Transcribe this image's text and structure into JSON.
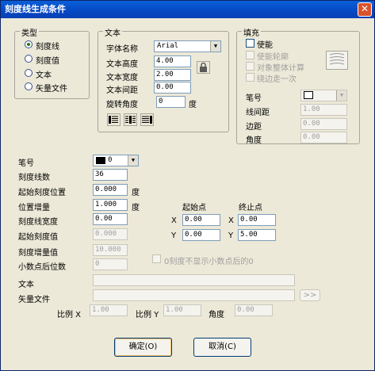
{
  "window": {
    "title": "刻度线生成条件",
    "close_label": "✕"
  },
  "type_group": {
    "legend": "类型",
    "options": [
      {
        "label": "刻度线",
        "selected": true
      },
      {
        "label": "刻度值",
        "selected": false
      },
      {
        "label": "文本",
        "selected": false
      },
      {
        "label": "矢量文件",
        "selected": false
      }
    ]
  },
  "text_group": {
    "legend": "文本",
    "font_name_label": "字体名称",
    "font_name_value": "Arial",
    "height_label": "文本高度",
    "height_value": "4.00",
    "width_label": "文本宽度",
    "width_value": "2.00",
    "spacing_label": "文本间距",
    "spacing_value": "0.00",
    "rotation_label": "旋转角度",
    "rotation_value": "0",
    "rotation_unit": "度"
  },
  "fill_group": {
    "legend": "填充",
    "enable_label": "使能",
    "outline_label": "使能轮廓",
    "whole_label": "对象整体计算",
    "once_label": "绕边走一次",
    "pen_label": "笔号",
    "line_spacing_label": "线间距",
    "line_spacing_value": "1.00",
    "margin_label": "边距",
    "margin_value": "0.00",
    "angle_label": "角度",
    "angle_value": "0.00"
  },
  "main": {
    "pen_label": "笔号",
    "pen_value": "0",
    "count_label": "刻度线数",
    "count_value": "36",
    "start_pos_label": "起始刻度位置",
    "start_pos_value": "0.000",
    "start_pos_unit": "度",
    "increment_label": "位置增量",
    "increment_value": "1.000",
    "increment_unit": "度",
    "line_width_label": "刻度线宽度",
    "line_width_value": "0.00",
    "start_val_label": "起始刻度值",
    "start_val_value": "0.000",
    "val_inc_label": "刻度增量值",
    "val_inc_value": "10.000",
    "decimals_label": "小数点后位数",
    "decimals_value": "0",
    "hide_zero_label": "0刻度不显示小数点后的0",
    "text_label": "文本",
    "text_value": "",
    "vector_label": "矢量文件",
    "vector_value": "",
    "browse_label": ">>",
    "start_point_label": "起始点",
    "end_point_label": "终止点",
    "sx_label": "X",
    "sx_value": "0.00",
    "sy_label": "Y",
    "sy_value": "0.00",
    "ex_label": "X",
    "ex_value": "0.00",
    "ey_label": "Y",
    "ey_value": "5.00",
    "scale_x_label": "比例 X",
    "scale_x_value": "1.00",
    "scale_y_label": "比例 Y",
    "scale_y_value": "1.00",
    "angle_label": "角度",
    "angle_value": "0.00"
  },
  "buttons": {
    "ok": "确定(O)",
    "cancel": "取消(C)"
  }
}
